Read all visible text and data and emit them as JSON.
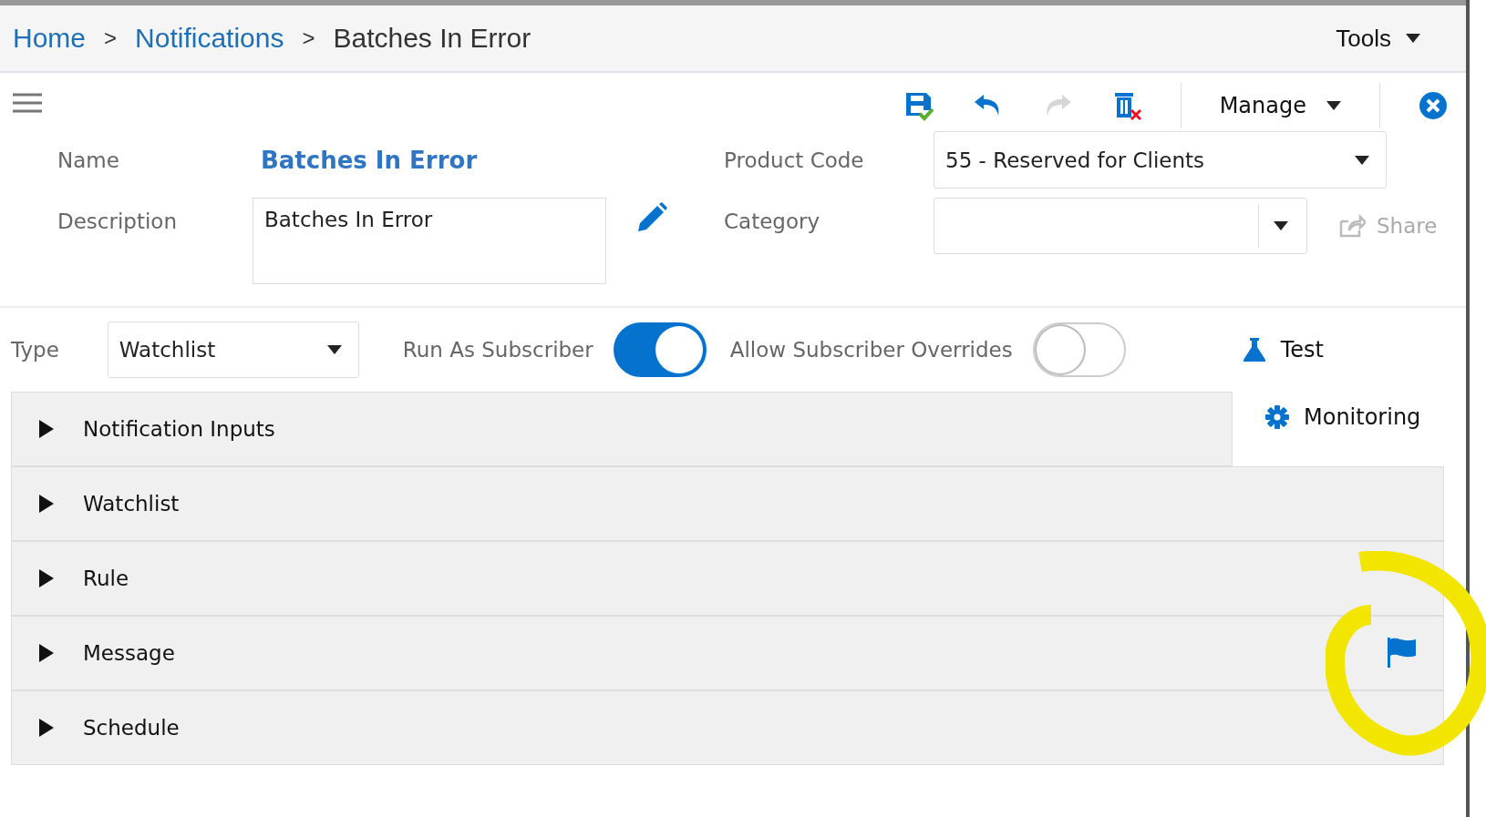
{
  "breadcrumb": [
    {
      "kind": "link",
      "text": "Home"
    },
    {
      "kind": "separator",
      "text": ">"
    },
    {
      "kind": "link",
      "text": "Notifications"
    },
    {
      "kind": "separator",
      "text": ">"
    },
    {
      "kind": "current",
      "text": "Batches In Error"
    }
  ],
  "tools_menu": {
    "label": "Tools"
  },
  "toolbar": {
    "actions": [
      {
        "kind": "save",
        "disabled": false
      },
      {
        "kind": "undo",
        "disabled": false
      },
      {
        "kind": "redo",
        "disabled": true
      },
      {
        "kind": "delete",
        "disabled": false
      }
    ],
    "manage": {
      "label": "Manage"
    }
  },
  "form": {
    "name": {
      "label": "Name",
      "value": "Batches In Error"
    },
    "product_code": {
      "label": "Product Code",
      "value": "55 - Reserved for Clients"
    },
    "description": {
      "label": "Description",
      "value": "Batches In Error"
    },
    "category": {
      "label": "Category"
    },
    "share": {
      "label": "Share",
      "disabled": true
    }
  },
  "type": {
    "label": "Type",
    "value": "Watchlist"
  },
  "toggles": [
    {
      "label": "Run As Subscriber",
      "on": true
    },
    {
      "label": "Allow Subscriber Overrides",
      "on": false
    }
  ],
  "side_actions": [
    {
      "kind": "test",
      "label": "Test"
    },
    {
      "kind": "monitoring",
      "label": "Monitoring"
    }
  ],
  "sections": [
    {
      "label": "Notification Inputs",
      "expanded": false,
      "flagged": false
    },
    {
      "label": "Watchlist",
      "expanded": false,
      "flagged": false
    },
    {
      "label": "Rule",
      "expanded": false,
      "flagged": false
    },
    {
      "label": "Message",
      "expanded": false,
      "flagged": true
    },
    {
      "label": "Schedule",
      "expanded": false,
      "flagged": false
    }
  ]
}
